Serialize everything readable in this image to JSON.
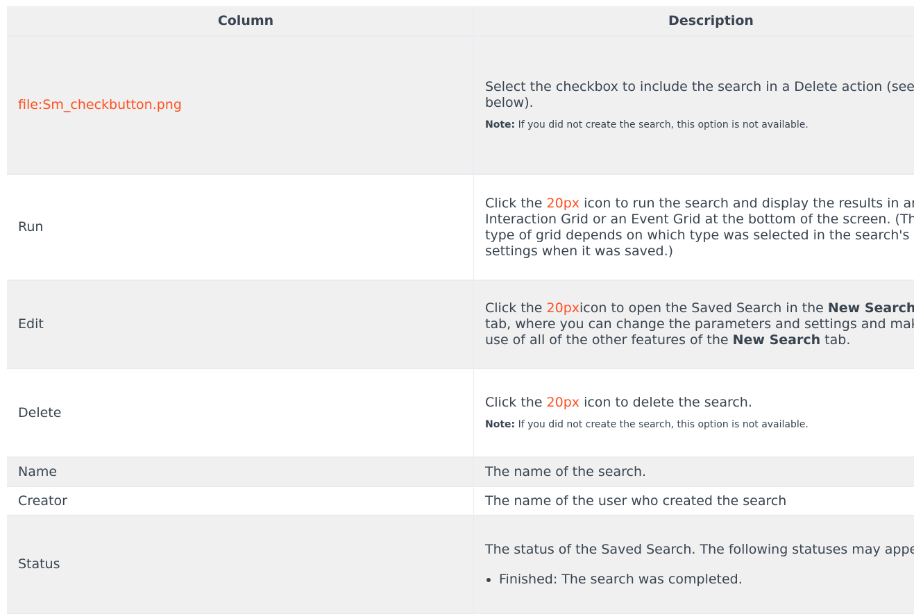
{
  "table": {
    "headers": [
      "Column",
      "Description"
    ],
    "rows": [
      {
        "column": "file:Sm_checkbutton.png",
        "desc": "Select the checkbox to include the search in a Delete action (see below).",
        "note_label": "Note:",
        "note_text": " If you did not create the search, this option is not available."
      },
      {
        "column": "Run",
        "pre": "Click the ",
        "link": "20px",
        "post": " icon to run the search and display the results in an Interaction Grid or an Event Grid at the bottom of the screen. (The type of grid depends on which type was selected in the search's settings when it was saved.)"
      },
      {
        "column": "Edit",
        "pre": "Click the ",
        "link": "20px",
        "mid1": "icon to open the Saved Search in the ",
        "bold1": "New Search",
        "mid2": " tab, where you can change the parameters and settings and make use of all of the other features of the ",
        "bold2": "New Search",
        "post": " tab."
      },
      {
        "column": "Delete",
        "pre": "Click the ",
        "link": "20px",
        "post": " icon to delete the search.",
        "note_label": "Note:",
        "note_text": " If you did not create the search, this option is not available."
      },
      {
        "column": "Name",
        "desc": "The name of the search."
      },
      {
        "column": "Creator",
        "desc": "The name of the user who created the search"
      },
      {
        "column": "Status",
        "desc": "The status of the Saved Search. The following statuses may appear:",
        "bullets": [
          "Finished: The search was completed."
        ]
      }
    ]
  },
  "colors": {
    "link": "#ff4f1f",
    "text": "#384450",
    "stripe": "#f0f0f0",
    "border": "#e8ecf0"
  }
}
